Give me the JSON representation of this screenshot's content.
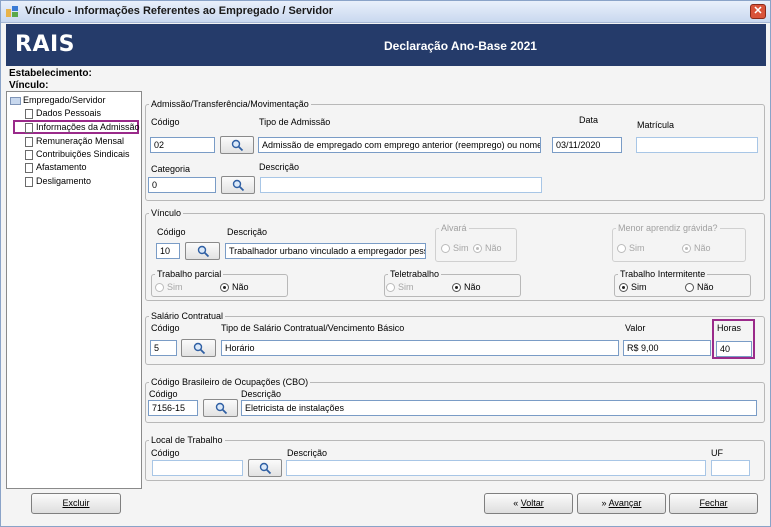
{
  "window": {
    "title": "Vínculo - Informações Referentes ao Empregado / Servidor",
    "close_glyph": "✕"
  },
  "banner": {
    "logo": "RAIS",
    "title": "Declaração Ano-Base 2021"
  },
  "header": {
    "estabelecimento": "Estabelecimento:",
    "vinculo": "Vínculo:"
  },
  "tree": {
    "root": "Empregado/Servidor",
    "items": [
      "Dados Pessoais",
      "Informações da Admissão",
      "Remuneração Mensal",
      "Contribuições Sindicais",
      "Afastamento",
      "Desligamento"
    ]
  },
  "admissao": {
    "legend": "Admissão/Transferência/Movimentação",
    "codigo_label": "Código",
    "codigo_value": "02",
    "tipo_label": "Tipo de Admissão",
    "tipo_value": "Admissão de empregado com emprego anterior (reemprego) ou nomeação",
    "data_label": "Data",
    "data_value": "03/11/2020",
    "matricula_label": "Matrícula",
    "matricula_value": "",
    "categoria_label": "Categoria",
    "categoria_value": "0",
    "descricao_label": "Descrição",
    "descricao_value": ""
  },
  "vinculo": {
    "legend": "Vínculo",
    "codigo_label": "Código",
    "codigo_value": "10",
    "descricao_label": "Descrição",
    "descricao_value": "Trabalhador urbano vinculado a empregador pessoa",
    "alvara": {
      "legend": "Alvará",
      "sim": "Sim",
      "nao": "Não",
      "selected": "nao"
    },
    "menor": {
      "legend": "Menor aprendiz grávida?",
      "sim": "Sim",
      "nao": "Não",
      "selected": "nao"
    },
    "parcial": {
      "legend": "Trabalho parcial",
      "sim": "Sim",
      "nao": "Não",
      "selected": "nao"
    },
    "teletrabalho": {
      "legend": "Teletrabalho",
      "sim": "Sim",
      "nao": "Não",
      "selected": "nao"
    },
    "intermitente": {
      "legend": "Trabalho Intermitente",
      "sim": "Sim",
      "nao": "Não",
      "selected": "sim"
    }
  },
  "salario": {
    "legend": "Salário Contratual",
    "codigo_label": "Código",
    "codigo_value": "5",
    "tipo_label": "Tipo de Salário Contratual/Vencimento Básico",
    "tipo_value": "Horário",
    "valor_label": "Valor",
    "valor_value": "R$ 9,00",
    "horas_label": "Horas",
    "horas_value": "40"
  },
  "cbo": {
    "legend": "Código Brasileiro de Ocupações (CBO)",
    "codigo_label": "Código",
    "codigo_value": "7156-15",
    "descricao_label": "Descrição",
    "descricao_value": "Eletricista de instalações"
  },
  "local": {
    "legend": "Local de Trabalho",
    "codigo_label": "Código",
    "codigo_value": "",
    "descricao_label": "Descrição",
    "descricao_value": "",
    "uf_label": "UF",
    "uf_value": ""
  },
  "footer": {
    "excluir": "Excluir",
    "voltar": "Voltar",
    "avancar": "Avançar",
    "fechar": "Fechar"
  },
  "colors": {
    "banner": "#253b6a",
    "highlight": "#9a2a8a",
    "field_border": "#7a9cc6"
  },
  "icons": {
    "search": "search-icon",
    "back": "double-chevron-left-icon",
    "forward": "double-chevron-right-icon"
  }
}
